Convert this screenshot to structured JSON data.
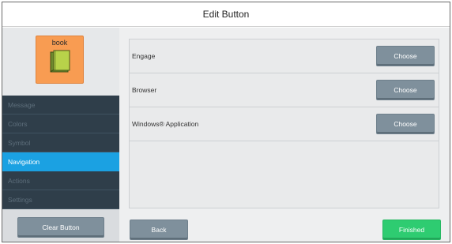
{
  "window": {
    "title": "Edit Button"
  },
  "preview": {
    "label": "book",
    "icon": "book-icon",
    "card_color": "#f89c52"
  },
  "sidebar": {
    "items": [
      {
        "label": "Message",
        "active": false
      },
      {
        "label": "Colors",
        "active": false
      },
      {
        "label": "Symbol",
        "active": false
      },
      {
        "label": "Navigation",
        "active": true
      },
      {
        "label": "Actions",
        "active": false
      },
      {
        "label": "Settings",
        "active": false
      }
    ],
    "clear_label": "Clear Button"
  },
  "main": {
    "rows": [
      {
        "label": "Engage",
        "button": "Choose"
      },
      {
        "label": "Browser",
        "button": "Choose"
      },
      {
        "label": "Windows® Application",
        "button": "Choose"
      }
    ]
  },
  "footer": {
    "back_label": "Back",
    "finished_label": "Finished"
  },
  "colors": {
    "accent": "#1ba1e2",
    "finished": "#2ecc71",
    "button_gray": "#7f909c",
    "sidebar_dark": "#2f3e4a"
  }
}
